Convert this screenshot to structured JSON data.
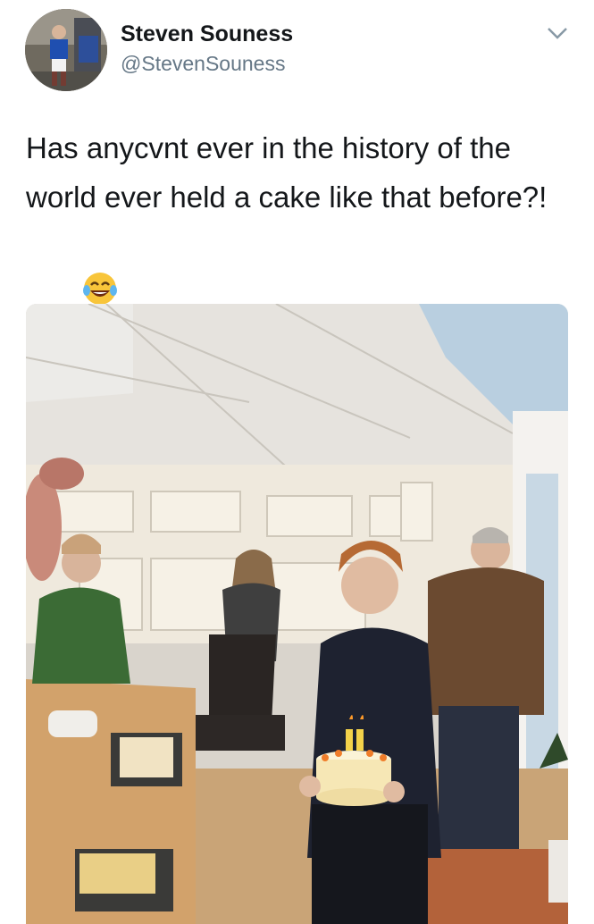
{
  "tweet": {
    "author": {
      "display_name": "Steven Souness",
      "handle": "@StevenSouness",
      "avatar_icon": "profile-photo"
    },
    "text": "Has anycvnt ever in the history of the world ever held a cake like that before?!",
    "emojis": [
      "face-with-tears-of-joy",
      "face-with-tears-of-joy",
      "face-with-tears-of-joy",
      "face-with-tears-of-joy"
    ],
    "menu_icon": "chevron-down-icon",
    "media": {
      "description_icon": "photo-conservatory-cake",
      "cake_candles": "50"
    }
  },
  "colors": {
    "name": "#14171a",
    "handle": "#657786",
    "chevron": "#8899a6"
  }
}
